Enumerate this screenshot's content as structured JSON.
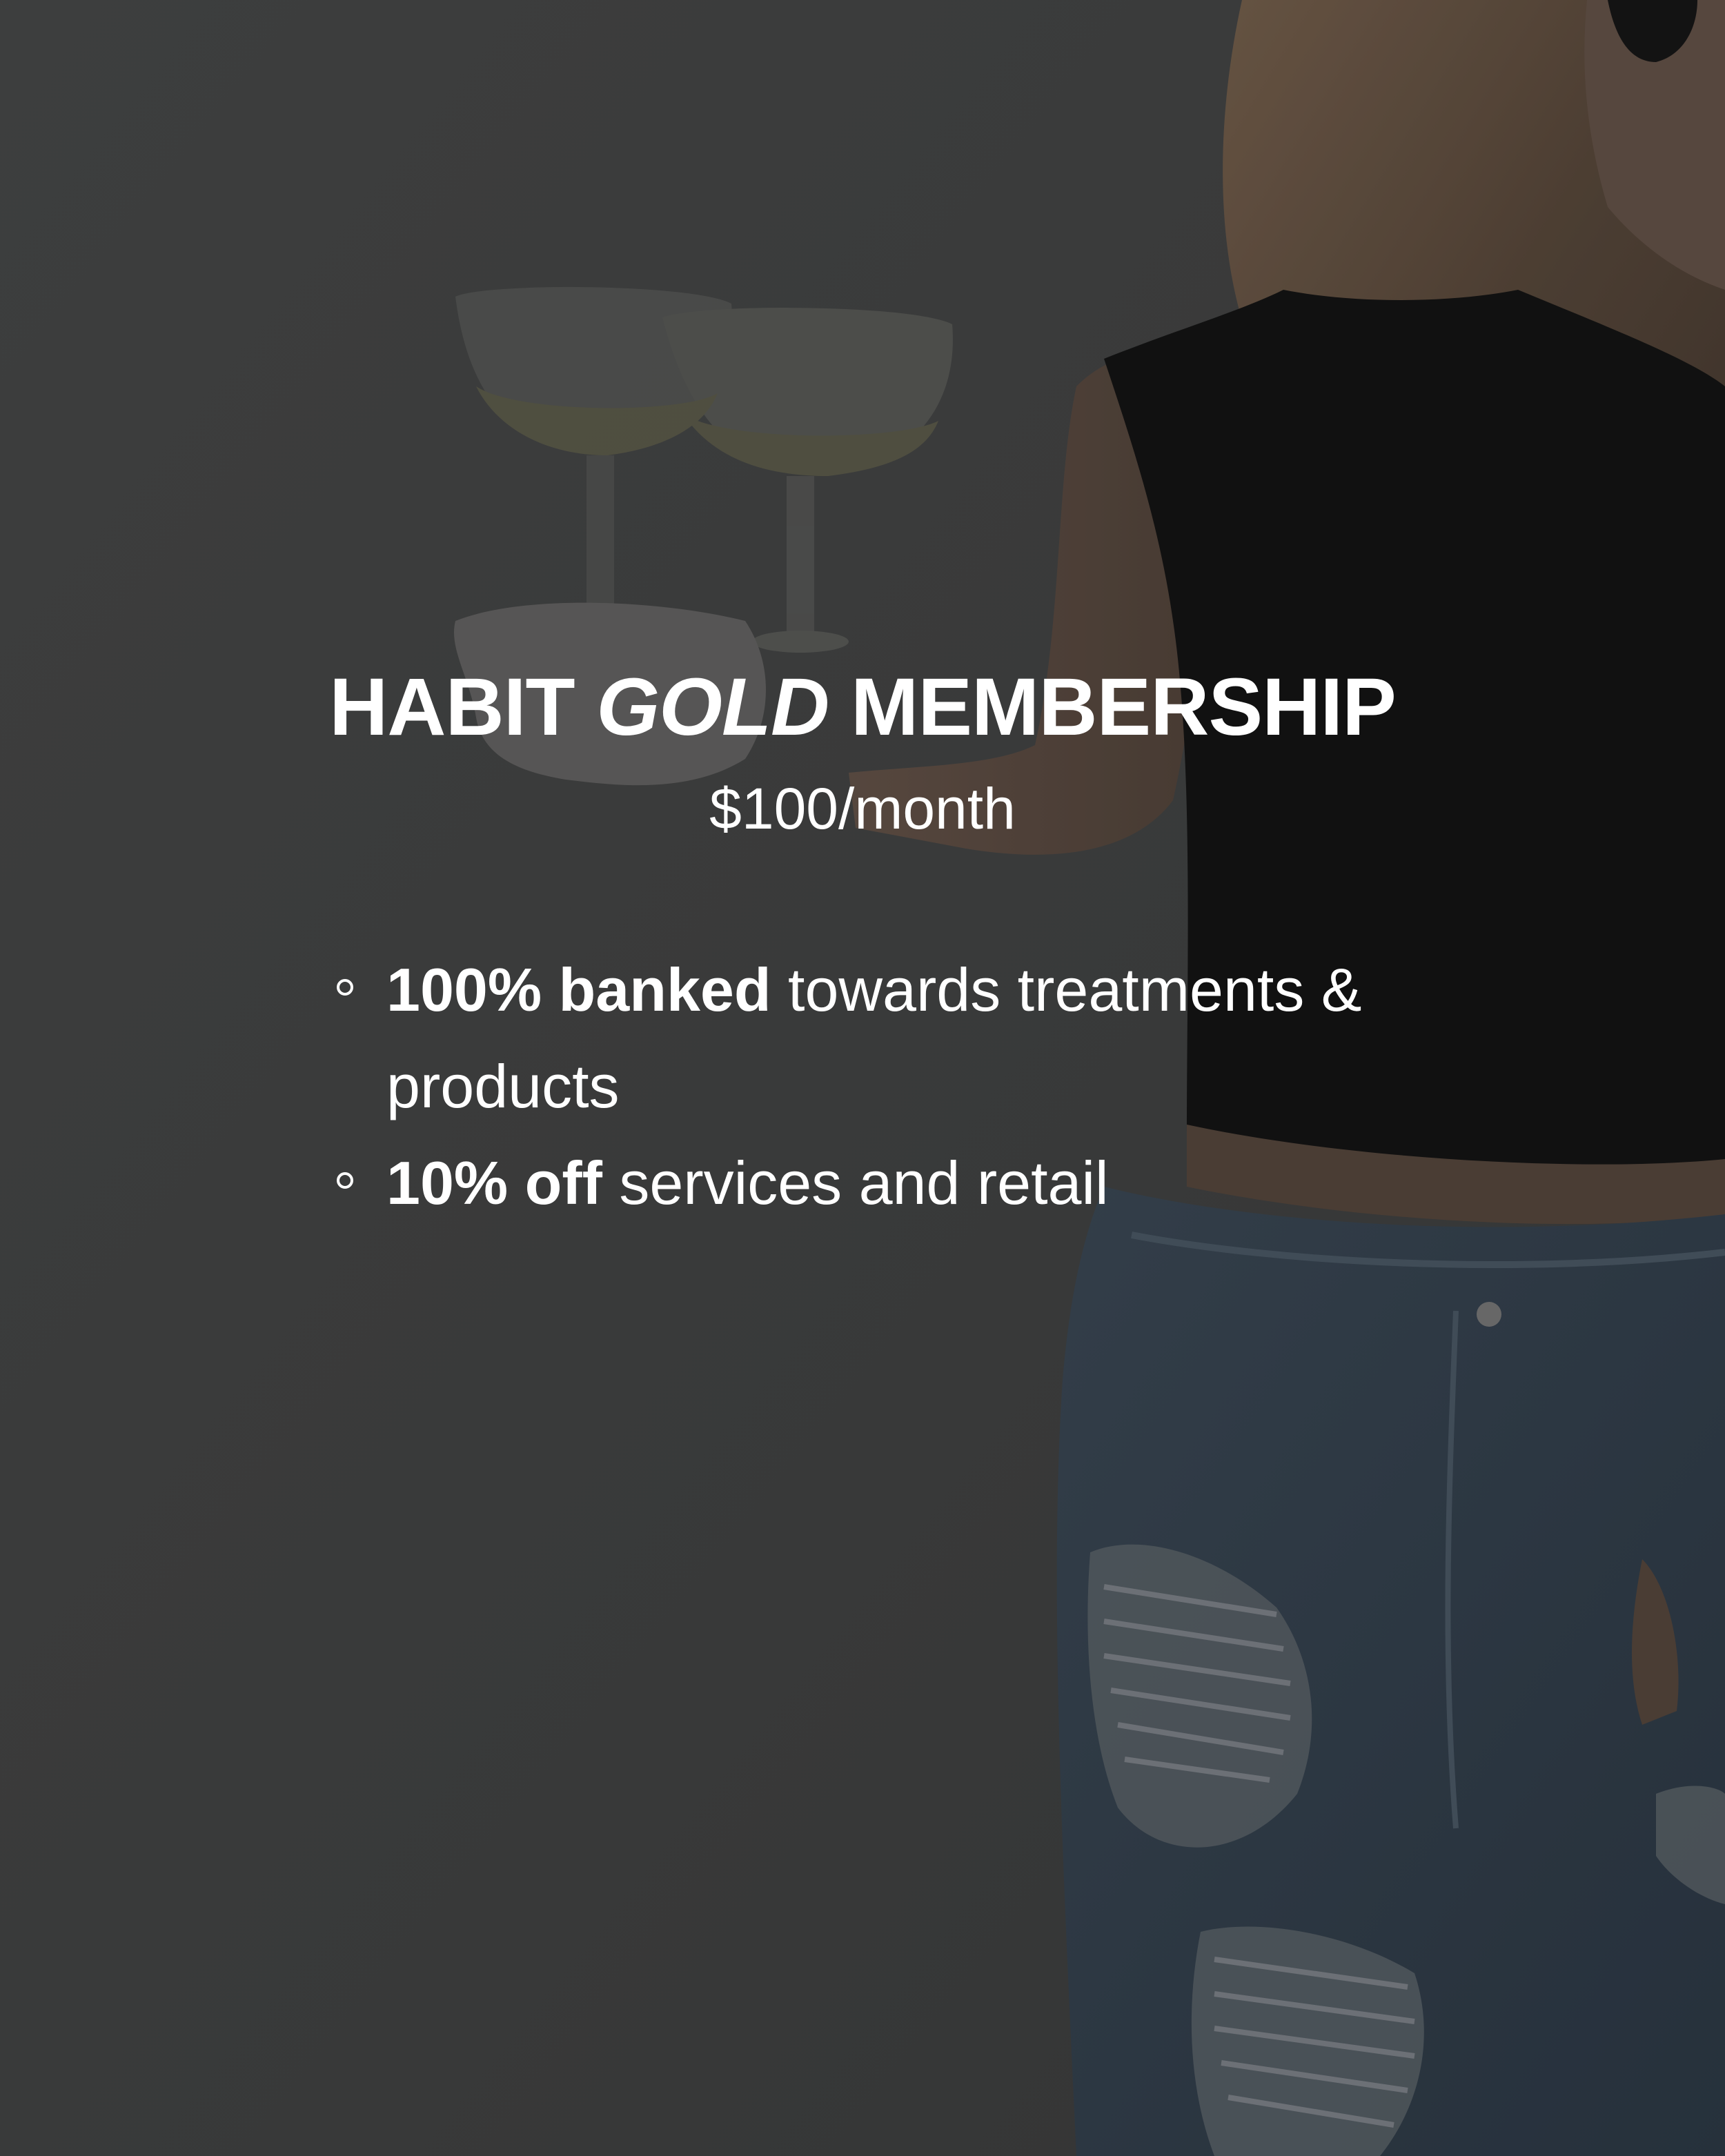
{
  "membership": {
    "title_before": "HABIT ",
    "title_emphasis": "GOLD",
    "title_after": " MEMBERSHIP",
    "price": "$100/month"
  },
  "benefits": [
    {
      "bold": "100% banked",
      "rest": " towards treatments & products"
    },
    {
      "bold": "10% off",
      "rest": " services and retail"
    }
  ]
}
